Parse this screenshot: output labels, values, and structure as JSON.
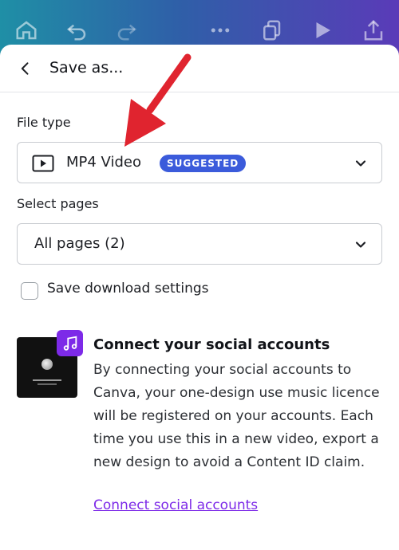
{
  "toolbar": {
    "icons": [
      "home-icon",
      "undo-icon",
      "redo-icon",
      "more-icon",
      "pages-icon",
      "play-icon",
      "share-icon"
    ]
  },
  "header": {
    "title": "Save as..."
  },
  "file_type": {
    "label": "File type",
    "value": "MP4 Video",
    "badge": "SUGGESTED"
  },
  "select_pages": {
    "label": "Select pages",
    "value": "All pages (2)"
  },
  "save_settings": {
    "label": "Save download settings",
    "checked": false
  },
  "connect": {
    "title": "Connect your social accounts",
    "body": "By connecting your social accounts to Canva, your one-design use music licence will be registered on your accounts. Each time you use this in a new video, export a new design to avoid a Content ID claim.",
    "link": "Connect social accounts"
  },
  "colors": {
    "accent_purple": "#7d2ae8",
    "badge_blue": "#3b5bdb",
    "annotation_arrow": "#e0242f"
  }
}
